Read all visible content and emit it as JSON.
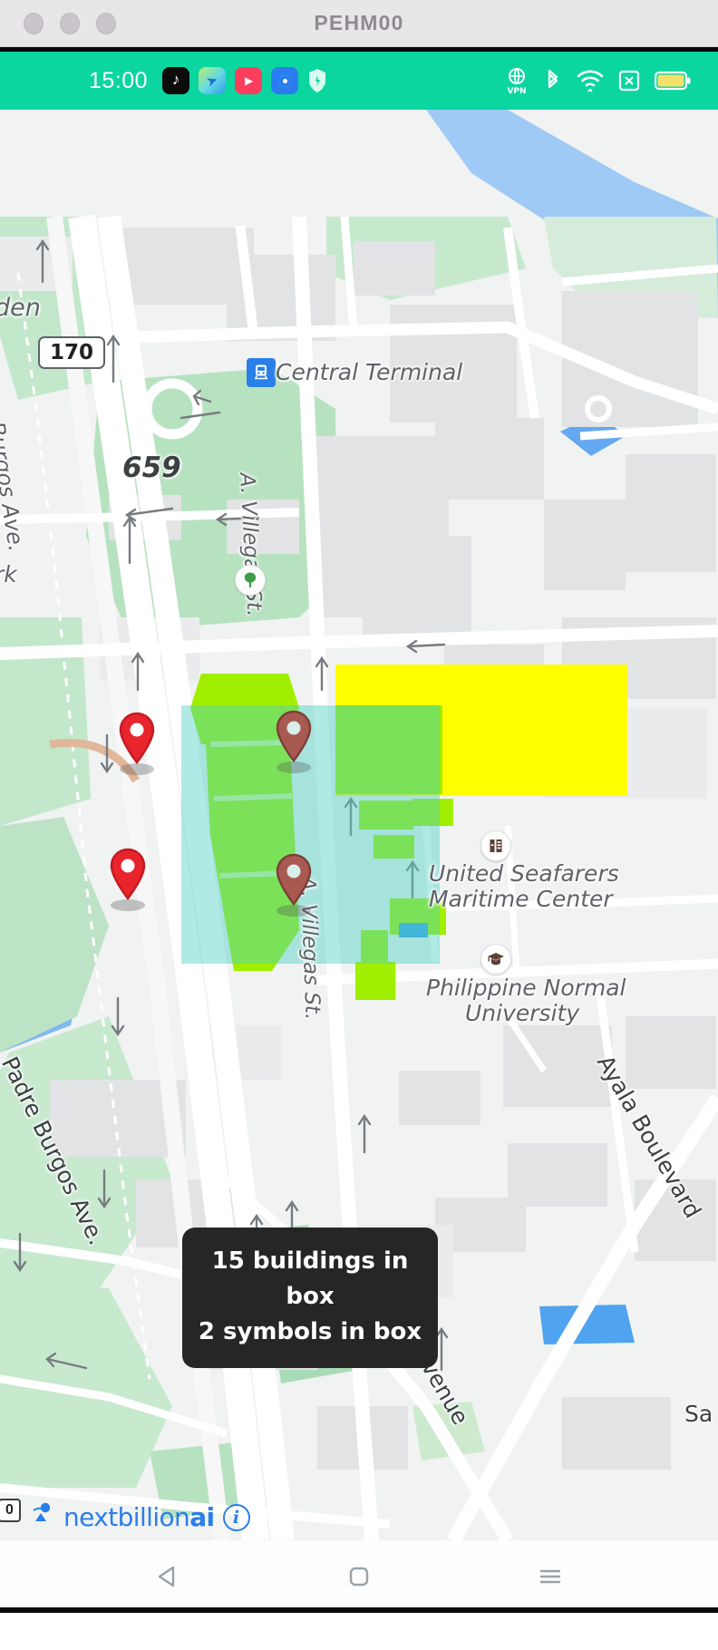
{
  "window": {
    "title": "PEHM00",
    "traffic_lights": [
      "close",
      "minimize",
      "zoom"
    ]
  },
  "status_bar": {
    "time": "15:00",
    "background_color": "#0bd6a0",
    "app_icons": [
      "tiktok-icon",
      "telegram-icon",
      "video-app-icon",
      "browser-app-icon",
      "shield-app-icon"
    ],
    "system_icons": [
      "vpn-icon",
      "bluetooth-icon",
      "wifi-icon",
      "sim-no-signal-icon",
      "battery-icon"
    ],
    "vpn_label": "VPN"
  },
  "map": {
    "route_shield": "170",
    "area_number": "659",
    "labels": [
      {
        "text": "den",
        "id": "garden-label"
      },
      {
        "text": "Central Terminal",
        "id": "central-terminal-label"
      },
      {
        "text": "A. Villegas St.",
        "id": "villegas-upper-label"
      },
      {
        "text": "A. Villegas St.",
        "id": "villegas-lower-label"
      },
      {
        "text": "rk",
        "id": "park-label"
      },
      {
        "text": "United Seafarers",
        "id": "seafarers-line1"
      },
      {
        "text": "Maritime Center",
        "id": "seafarers-line2"
      },
      {
        "text": "Philippine Normal",
        "id": "pnu-line1"
      },
      {
        "text": "University",
        "id": "pnu-line2"
      },
      {
        "text": "Padre Burgos Ave.",
        "id": "padre-burgos-lower-label"
      },
      {
        "text": "e Burgos Ave.",
        "id": "padre-burgos-upper-label"
      },
      {
        "text": "Ayala Boulevard",
        "id": "ayala-boulevard-label"
      },
      {
        "text": "Taft Avenue",
        "id": "taft-avenue-label"
      },
      {
        "text": "Sa",
        "id": "sa-clipped-label"
      }
    ],
    "pois": [
      {
        "name": "central-terminal",
        "icon": "train-station-icon"
      },
      {
        "name": "park-tree",
        "icon": "tree-icon"
      },
      {
        "name": "united-seafarers",
        "icon": "building-icon"
      },
      {
        "name": "philippine-normal-university",
        "icon": "graduation-cap-icon"
      }
    ],
    "markers": [
      {
        "id": "marker-1",
        "state": "outside-box",
        "color": "#e8242c"
      },
      {
        "id": "marker-2",
        "state": "outside-box",
        "color": "#e8242c"
      },
      {
        "id": "marker-3",
        "state": "inside-box",
        "color": "#a85a52"
      },
      {
        "id": "marker-4",
        "state": "inside-box",
        "color": "#a85a52"
      }
    ],
    "selection_box": {
      "fill_color": "#4dd0c4",
      "highlight_building_color": "#a0ee00",
      "unselected_building_color": "#ffff00"
    },
    "toast": {
      "line1": "15 buildings in box",
      "line2": "2 symbols in box",
      "background_color": "#262626"
    },
    "attribution": {
      "brand_prefix": "nextbillion",
      "brand_suffix": "ai",
      "info_glyph": "i",
      "scale_text": "0"
    }
  },
  "nav_bar": {
    "buttons": [
      {
        "label": "Back",
        "icon": "back-triangle-icon"
      },
      {
        "label": "Home",
        "icon": "home-square-icon"
      },
      {
        "label": "Recents",
        "icon": "menu-lines-icon"
      }
    ]
  }
}
